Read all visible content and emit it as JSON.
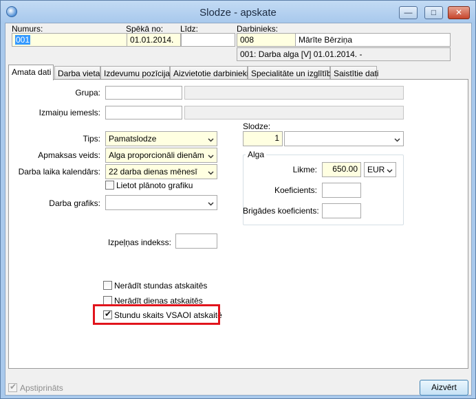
{
  "window": {
    "title": "Slodze - apskate",
    "minimize_glyph": "—",
    "maximize_glyph": "□",
    "close_glyph": "✕"
  },
  "header": {
    "numurs_label": "Numurs:",
    "numurs_value": "001",
    "speka_label": "Spēkā no:",
    "speka_value": "01.01.2014.",
    "lidz_label": "Līdz:",
    "lidz_value": "",
    "darbinieks_label": "Darbinieks:",
    "darbinieks_code": "008",
    "darbinieks_name": "Mārīte Bērziņa",
    "darbinieks_info": "001: Darba alga [V] 01.01.2014. -"
  },
  "tabs": [
    {
      "label": "Amata dati",
      "active": true
    },
    {
      "label": "Darba vieta",
      "active": false
    },
    {
      "label": "Izdevumu pozīcijas",
      "active": false
    },
    {
      "label": "Aizvietotie darbinieki",
      "active": false
    },
    {
      "label": "Specialitāte un izglītība",
      "active": false
    },
    {
      "label": "Saistītie dati",
      "active": false
    }
  ],
  "form": {
    "grupa_label": "Grupa:",
    "izmainu_label": "Izmaiņu iemesls:",
    "tips_label": "Tips:",
    "tips_value": "Pamatslodze",
    "apmaksas_label": "Apmaksas veids:",
    "apmaksas_value": "Alga proporcionāli dienām",
    "kalendars_label": "Darba laika kalendārs:",
    "kalendars_value": "22 darba dienas mēnesī",
    "planoto_label": "Lietot plānoto grafiku",
    "planoto_checked": false,
    "grafiks_label": "Darba grafiks:",
    "grafiks_value": "",
    "izpelnas_label": "Izpeļņas indekss:",
    "izpelnas_value": "",
    "slodze_label": "Slodze:",
    "slodze_value": "1",
    "alga_group_title": "Alga",
    "likme_label": "Likme:",
    "likme_value": "650.00",
    "currency_value": "EUR",
    "koef_label": "Koeficients:",
    "koef_value": "",
    "brig_label": "Brigādes koeficients:",
    "brig_value": "",
    "nerad_stundas_label": "Nerādīt stundas atskaitēs",
    "nerad_stundas_checked": false,
    "nerad_dienas_label": "Nerādīt dienas atskaitēs",
    "nerad_dienas_checked": false,
    "stundu_vsaoi_label": "Stundu skaits VSAOI atskaitē",
    "stundu_vsaoi_checked": true
  },
  "footer": {
    "apstiprinats_label": "Apstiprināts",
    "apstiprinats_checked": true,
    "close_button_label": "Aizvērt"
  },
  "colors": {
    "highlight": "#e1141c",
    "required_field": "#ffffe1",
    "selection": "#3399ff"
  }
}
